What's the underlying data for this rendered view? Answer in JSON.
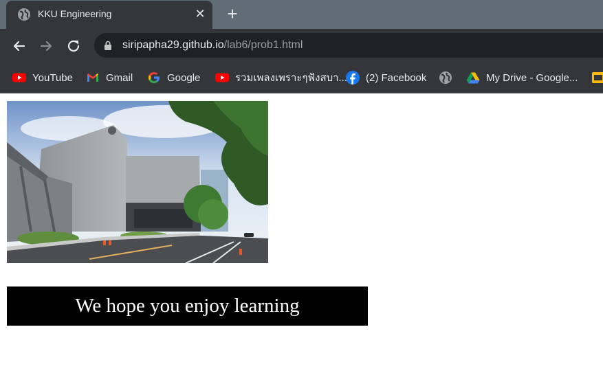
{
  "tab": {
    "title": "KKU Engineering",
    "favicon": "globe-icon",
    "close_icon": "close-icon",
    "new_tab_icon": "plus-icon"
  },
  "toolbar": {
    "back_icon": "back-arrow-icon",
    "forward_icon": "forward-arrow-icon",
    "reload_icon": "reload-icon",
    "url_host": "siripapha29.github.io",
    "url_path": "/lab6/prob1.html"
  },
  "bookmarks": [
    {
      "label": "YouTube",
      "icon": "youtube-icon"
    },
    {
      "label": "Gmail",
      "icon": "gmail-icon"
    },
    {
      "label": "Google",
      "icon": "google-icon"
    },
    {
      "label": "รวมเพลงเพราะๆฟังสบา...",
      "icon": "youtube-icon"
    },
    {
      "label": "(2) Facebook",
      "icon": "facebook-icon"
    },
    {
      "label": "",
      "icon": "globe-icon"
    },
    {
      "label": "My Drive - Google...",
      "icon": "google-drive-icon"
    }
  ],
  "page": {
    "image_alt": "KKU Engineering building",
    "banner_text": "We hope you enjoy learning"
  },
  "colors": {
    "tab_strip": "#5f6e76",
    "toolbar": "#35363a",
    "urlbar": "#202124",
    "banner_bg": "#000000",
    "banner_text": "#ffffff"
  }
}
